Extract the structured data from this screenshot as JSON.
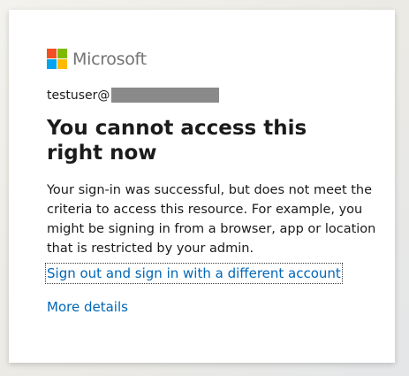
{
  "brand": {
    "logo_text": "Microsoft",
    "colors": {
      "red": "#f25022",
      "green": "#7fba00",
      "blue": "#00a4ef",
      "yellow": "#ffb900"
    }
  },
  "identity": {
    "username": "testuser@"
  },
  "title": "You cannot access this right now",
  "description": "Your sign-in was successful, but does not meet the criteria to access this resource. For example, you might be signing in from a browser, app or location that is restricted by your admin.",
  "links": {
    "sign_out": "Sign out and sign in with a different account",
    "more_details": "More details"
  },
  "accent_color": "#0067b8"
}
